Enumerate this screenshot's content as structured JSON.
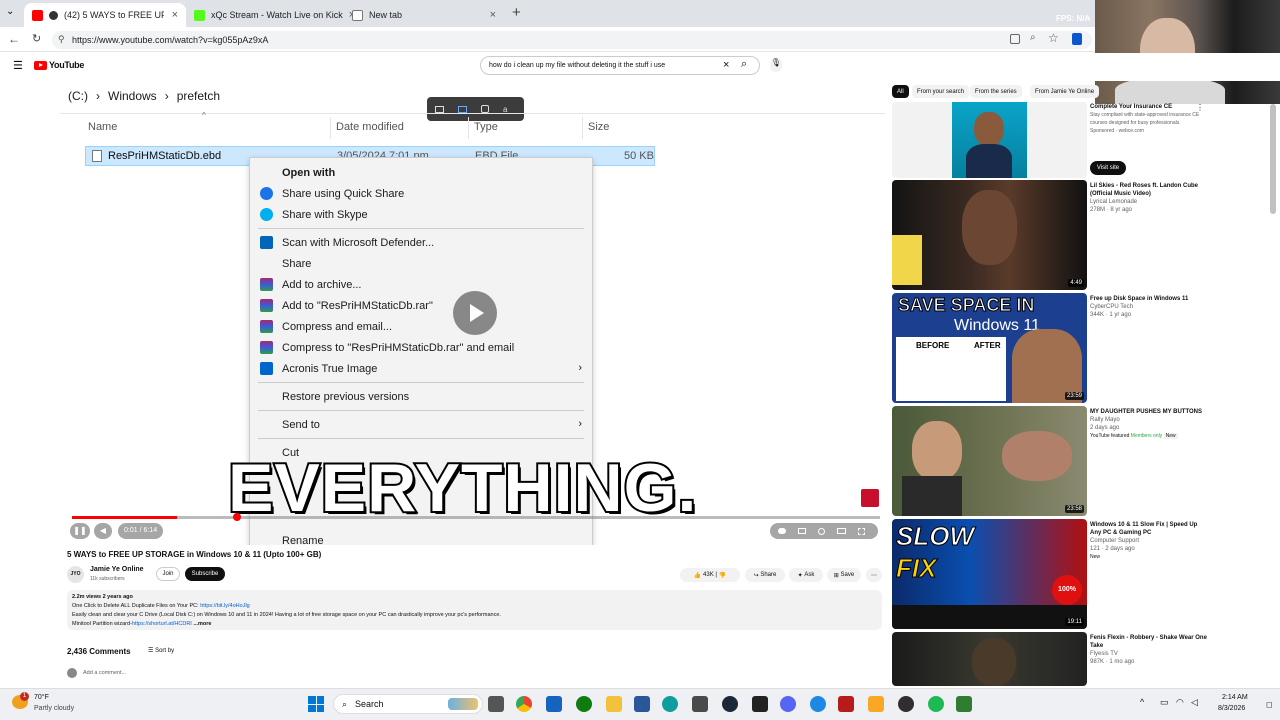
{
  "browser": {
    "tabs": [
      {
        "label": "(42) 5 WAYS to FREE UP STORA",
        "active": true
      },
      {
        "label": "xQc Stream - Watch Live on Kick",
        "active": false
      },
      {
        "label": "New tab",
        "active": false
      }
    ],
    "new_tab_symbol": "+",
    "url": "https://www.youtube.com/watch?v=kg055pAz9xA",
    "stream_overlay": "FPS: N/A"
  },
  "youtube": {
    "logo_text": "YouTube",
    "search_query": "how do i clean up my file without deleting it the stuff i use"
  },
  "explorer": {
    "breadcrumb": {
      "drive": "(C:)",
      "folder1": "Windows",
      "folder2": "prefetch"
    },
    "columns": {
      "name": "Name",
      "date": "Date modified",
      "type": "Type",
      "size": "Size"
    },
    "file": {
      "name": "ResPriHMStaticDb.ebd",
      "date": "3/05/2024 7:01 pm",
      "type": "EBD File",
      "size": "50 KB"
    }
  },
  "context_menu": {
    "items": [
      {
        "label": "Open with",
        "bold": true
      },
      {
        "label": "Share using Quick Share",
        "icon": "quick-share-icon"
      },
      {
        "label": "Share with Skype",
        "icon": "skype-icon"
      },
      {
        "label": "Scan with Microsoft Defender...",
        "icon": "defender-icon"
      },
      {
        "label": "Share"
      },
      {
        "label": "Add to archive...",
        "icon": "winrar-icon"
      },
      {
        "label": "Add to \"ResPriHMStaticDb.rar\"",
        "icon": "winrar-icon"
      },
      {
        "label": "Compress and email...",
        "icon": "winrar-icon"
      },
      {
        "label": "Compress to \"ResPriHMStaticDb.rar\" and email",
        "icon": "winrar-icon"
      },
      {
        "label": "Acronis True Image",
        "icon": "acronis-icon"
      },
      {
        "label": "Restore previous versions"
      },
      {
        "label": "Send to"
      },
      {
        "label": "Cut"
      },
      {
        "label": "Rename"
      }
    ]
  },
  "video": {
    "caption": "EVERYTHING.",
    "time": "0:01 / 6:14",
    "progress": 0.13,
    "title": "5 WAYS to FREE UP STORAGE in Windows 10 & 11 (Upto 100+ GB)"
  },
  "channel": {
    "avatar_text": "JYO",
    "name": "Jamie Ye Online",
    "subs": "11k subscribers",
    "join": "Join",
    "subscribe": "Subscribe"
  },
  "actions": {
    "likes": "43K",
    "share": "Share",
    "ask": "Ask",
    "save": "Save",
    "more": "⋯"
  },
  "description": {
    "views": "2.2m views  2 years ago",
    "line1": "One Click to Delete ALL Duplicate Files on Your PC:",
    "link1": "https://bit.ly/4oHoJlg",
    "line2": "Easily clean and clear your C Drive (Local Disk C:) on Windows 10 and 11 in 2024! Having a lot of free storage space on your PC can drastically improve your pc's performance.",
    "line3": "Minitool Partition wizard-",
    "link3": "https://shorturl.at/HCDRI",
    "more": "...more"
  },
  "comments": {
    "count": "2,436 Comments",
    "sort": "Sort by",
    "placeholder": "Add a comment..."
  },
  "filters": [
    "All",
    "From your search",
    "From the series",
    "From Jamie Ye Online"
  ],
  "recommended": [
    {
      "title": "Complete Your Insurance CE",
      "sub1": "Stay compliant with state-approved insurance CE courses designed for busy professionals.",
      "sub2": "Sponsored · webce.com",
      "button": "Visit site",
      "duration": ""
    },
    {
      "title": "Lil Skies - Red Roses ft. Landon Cube (Official Music Video)",
      "sub1": "Lyrical Lemonade",
      "sub2": "278M · 8 yr ago",
      "duration": "4:49"
    },
    {
      "title": "Free up Disk Space in Windows 11",
      "sub1": "CyberCPU Tech",
      "sub2": "344K · 1 yr ago",
      "duration": "23:59",
      "thumb_text": "SAVE SPACE IN",
      "thumb_sub": "Windows 11",
      "before": "BEFORE",
      "after": "AFTER"
    },
    {
      "title": "MY DAUGHTER PUSHES MY BUTTONS",
      "sub1": "Rally Mayo",
      "sub2": "2 days ago",
      "badge": "Members only",
      "badge2": "New",
      "yt_featured": "YouTube featured",
      "duration": "23:58"
    },
    {
      "title": "Windows 10 & 11 Slow Fix | Speed Up Any PC & Gaming PC",
      "sub1": "Computer Support",
      "sub2": "121 · 2 days ago",
      "new": "New",
      "duration": "19:11",
      "thumb_text": "SLOW",
      "thumb_sub": "FIX",
      "pct": "100%"
    },
    {
      "title": "Fenis Flexin - Robbery - Shake Wear One Take",
      "sub1": "Flyesis TV",
      "sub2": "987K · 1 mo ago",
      "duration": ""
    }
  ],
  "taskbar": {
    "weather_temp": "70°F",
    "weather_desc": "Partly cloudy",
    "search": "Search",
    "time": "2:14 AM",
    "date": "8/3/2026",
    "notif_count": "1"
  },
  "colors": {
    "yt_red": "#ff0000",
    "accent": "#0b57d0",
    "explorer_sel": "#cce8ff"
  }
}
